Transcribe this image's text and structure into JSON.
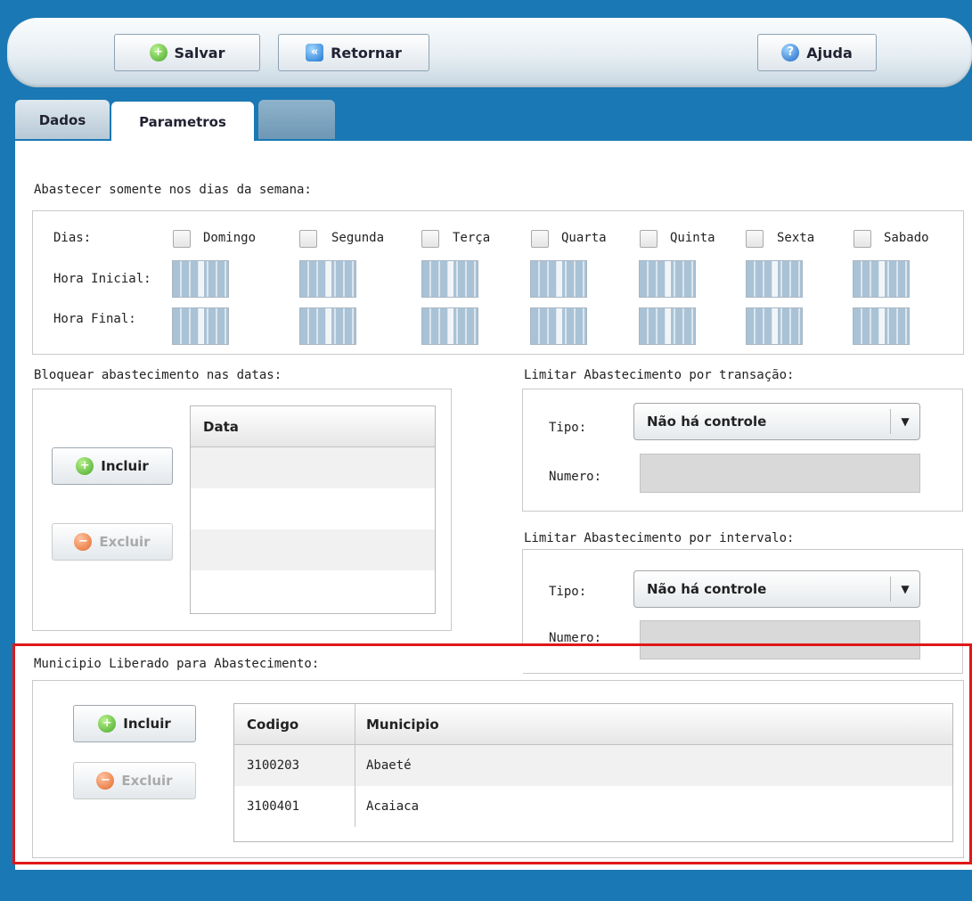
{
  "toolbar": {
    "save_label": "Salvar",
    "back_label": "Retornar",
    "help_label": "Ajuda"
  },
  "tabs": [
    {
      "label": "Dados",
      "active": false
    },
    {
      "label": "Parametros",
      "active": true
    },
    {
      "label": "",
      "active": false
    }
  ],
  "week": {
    "section_label": "Abastecer somente nos dias da semana:",
    "days_label": "Dias:",
    "start_label": "Hora Inicial:",
    "end_label": "Hora Final:",
    "days": [
      "Domingo",
      "Segunda",
      "Terça",
      "Quarta",
      "Quinta",
      "Sexta",
      "Sabado"
    ]
  },
  "block_dates": {
    "section_label": "Bloquear abastecimento nas datas:",
    "add_label": "Incluir",
    "remove_label": "Excluir",
    "column": "Data"
  },
  "limit_transaction": {
    "section_label": "Limitar Abastecimento por transação:",
    "type_label": "Tipo:",
    "type_value": "Não há controle",
    "number_label": "Numero:"
  },
  "limit_interval": {
    "section_label": "Limitar Abastecimento por intervalo:",
    "type_label": "Tipo:",
    "type_value": "Não há controle",
    "number_label": "Numero:"
  },
  "municipio": {
    "section_label": "Municipio Liberado para Abastecimento:",
    "add_label": "Incluir",
    "remove_label": "Excluir",
    "columns": [
      "Codigo",
      "Municipio"
    ],
    "rows": [
      {
        "codigo": "3100203",
        "municipio": "Abaeté"
      },
      {
        "codigo": "3100401",
        "municipio": "Acaiaca"
      }
    ]
  },
  "colors": {
    "background": "#1a78b4",
    "highlight": "#e01818"
  }
}
